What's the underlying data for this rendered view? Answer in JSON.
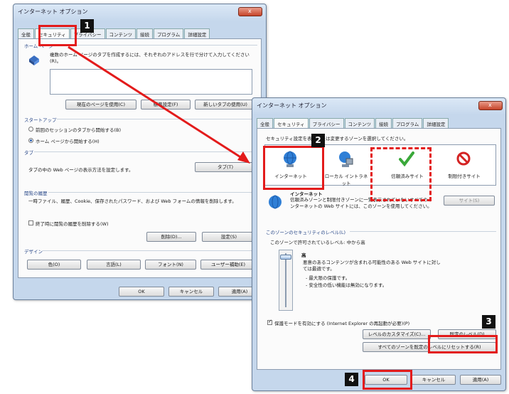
{
  "title": "インターネット オプション",
  "tabs": [
    "全般",
    "セキュリティ",
    "プライバシー",
    "コンテンツ",
    "接続",
    "プログラム",
    "詳細設定"
  ],
  "back_dialog": {
    "homepage_group": "ホーム ページ",
    "homepage_desc": "複数のホーム ページのタブを作成するには、それぞれのアドレスを行で分けて入力してください(R)。",
    "home_buttons": [
      "現在のページを使用(C)",
      "標準設定(F)",
      "新しいタブの使用(U)"
    ],
    "startup_group": "スタートアップ",
    "startup_options": [
      "前回のセッションのタブから開始する(B)",
      "ホーム ページから開始する(H)"
    ],
    "tabs_group": "タブ",
    "tabs_desc": "タブの中の Web ページの表示方法を設定します。",
    "tabs_button": "タブ(T)",
    "history_group": "閲覧の履歴",
    "history_desc": "一時ファイル、履歴、Cookie、保存されたパスワード、および Web フォームの情報を削除します。",
    "history_check": "終了時に閲覧の履歴を削除する(W)",
    "history_buttons": [
      "削除(D)...",
      "設定(S)"
    ],
    "design_group": "デザイン",
    "design_buttons": [
      "色(O)",
      "言語(L)",
      "フォント(N)",
      "ユーザー補助(E)"
    ],
    "footer_buttons": [
      "OK",
      "キャンセル",
      "適用(A)"
    ]
  },
  "front_dialog": {
    "zone_prompt": "セキュリティ設定を表示または変更するゾーンを選択してください。",
    "zones": [
      "インターネット",
      "ローカル イントラネット",
      "信頼済みサイト",
      "制限付きサイト"
    ],
    "zone_title": "インターネット",
    "zone_desc": "信頼済みゾーンと制限付きゾーンに一覧表示されていないすべてのインターネットの Web サイトには、このゾーンを使用してください。",
    "sites_button": "サイト(S)",
    "level_group": "このゾーンのセキュリティのレベル(L)",
    "level_allowed": "このゾーンで許可されているレベル: 中から高",
    "level_name": "高",
    "level_points": [
      "悪意のあるコンテンツが含まれる可能性のある Web サイトに対しては最適です。",
      "- 最大限の保護です。",
      "- 安全性の低い機能は無効になります。"
    ],
    "protected_mode": "保護モードを有効にする (Internet Explorer の再起動が必要)(P)",
    "custom_button": "レベルのカスタマイズ(C)...",
    "default_button": "既定のレベル(D)",
    "reset_all_button": "すべてのゾーンを既定のレベルにリセットする(R)",
    "footer_buttons": [
      "OK",
      "キャンセル",
      "適用(A)"
    ]
  },
  "callouts": [
    "1",
    "2",
    "3",
    "4"
  ],
  "colors": {
    "highlight": "#e31b1b",
    "badge": "#111111",
    "dialog_frame": "#c5d7ec"
  }
}
